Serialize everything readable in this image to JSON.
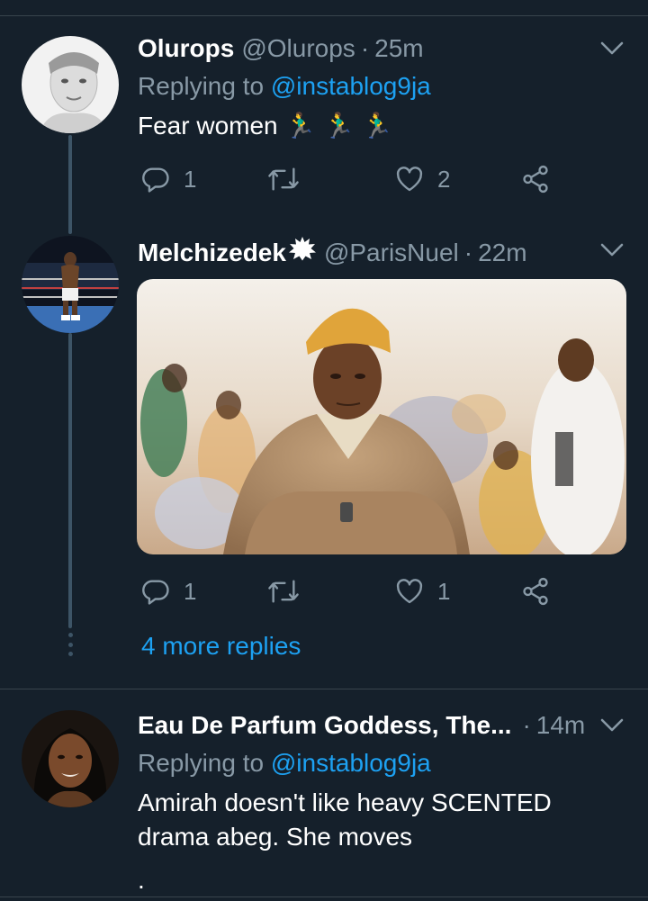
{
  "tweets": [
    {
      "name": "Olurops",
      "handle": "@Olurops",
      "time": "25m",
      "replying_label": "Replying to",
      "replying_to": "@instablog9ja",
      "text": "Fear women 🏃‍♂️ 🏃‍♂️ 🏃‍♂️",
      "replies": "1",
      "likes": "2"
    },
    {
      "name": "Melchizedek",
      "handle": "@ParisNuel",
      "time": "22m",
      "replies": "1",
      "likes": "1"
    },
    {
      "name": "Eau De Parfum Goddess, The...",
      "handle": "",
      "time": "14m",
      "replying_label": "Replying to",
      "replying_to": "@instablog9ja",
      "text_line1": "Amirah doesn't like heavy SCENTED",
      "text_line2": "drama abeg. She moves",
      "text_line3": "."
    }
  ],
  "more_replies": "4 more replies",
  "separator": "·",
  "icons": [
    "chevron-down-icon",
    "reply-icon",
    "retweet-icon",
    "like-icon",
    "share-icon",
    "verified-badge-icon"
  ],
  "colors": {
    "background": "#15202b",
    "link": "#1da1f2",
    "muted": "#8899a6",
    "divider": "#38444d"
  }
}
